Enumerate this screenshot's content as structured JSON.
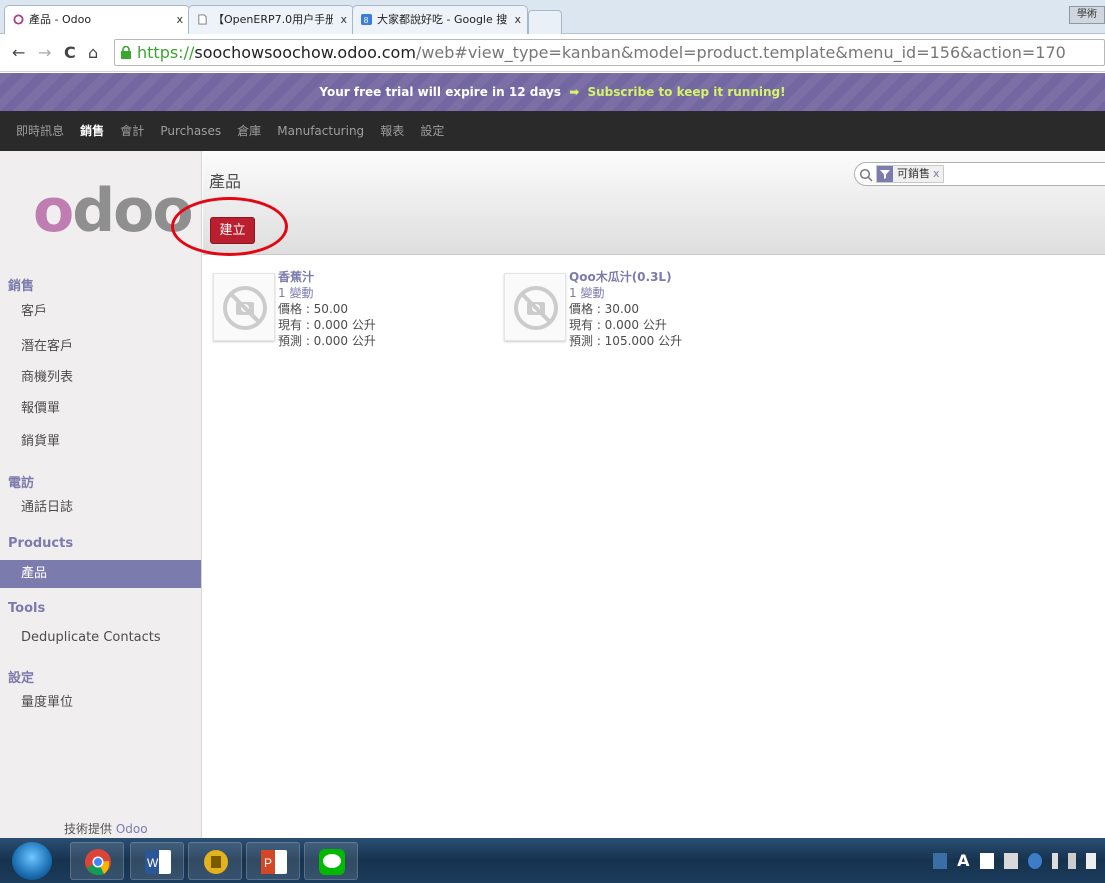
{
  "browser": {
    "tabs": [
      {
        "title": "產品 - Odoo",
        "close": "x"
      },
      {
        "title": "【OpenERP7.0用户手册】",
        "close": "x"
      },
      {
        "title": "大家都說好吃 - Google 搜",
        "close": "x"
      }
    ],
    "top_right_label": "學術",
    "nav": {
      "back": "←",
      "forward": "→",
      "reload": "C",
      "home": "⌂"
    },
    "url": {
      "scheme": "https://",
      "host": "soochowsoochow.odoo.com",
      "path": "/web#view_type=kanban&model=product.template&menu_id=156&action=170"
    }
  },
  "trial": {
    "text": "Your free trial will expire in 12 days",
    "arrow": "➡",
    "subscribe": "Subscribe to keep it running!"
  },
  "topmenu": [
    "即時訊息",
    "銷售",
    "會計",
    "Purchases",
    "倉庫",
    "Manufacturing",
    "報表",
    "設定"
  ],
  "sidebar": {
    "logo_main": "o",
    "logo_rest": "doo",
    "sections": [
      {
        "title": "銷售",
        "items": [
          "客戶",
          "潛在客戶",
          "商機列表",
          "報價單",
          "銷貨單"
        ]
      },
      {
        "title": "電訪",
        "items": [
          "通話日誌"
        ]
      },
      {
        "title": "Products",
        "items": [
          "產品"
        ]
      },
      {
        "title": "Tools",
        "items": [
          "Deduplicate Contacts"
        ]
      },
      {
        "title": "設定",
        "items": [
          "量度單位"
        ]
      }
    ],
    "active_item": "產品",
    "powered_prefix": "技術提供",
    "powered_brand": "Odoo"
  },
  "main": {
    "title": "產品",
    "create_label": "建立",
    "search": {
      "facet_label": "可銷售",
      "facet_remove": "x"
    },
    "products": [
      {
        "name": "香蕉汁",
        "variants": "1 變動",
        "price": "價格 : 50.00",
        "on_hand": "現有 : 0.000 公升",
        "forecast": "預測 : 0.000 公升"
      },
      {
        "name": "Qoo木瓜汁(0.3L)",
        "variants": "1 變動",
        "price": "價格 : 30.00",
        "on_hand": "現有 : 0.000 公升",
        "forecast": "預測 : 105.000 公升"
      }
    ]
  },
  "taskbar": {
    "apps": [
      "chrome-icon",
      "word-icon",
      "app-icon",
      "powerpoint-icon",
      "line-icon"
    ],
    "tray_text": "A"
  },
  "colors": {
    "accent": "#7c7bad",
    "brand": "#a24689",
    "create_button": "#b91f2e",
    "annotation_circle": "#e30613"
  }
}
